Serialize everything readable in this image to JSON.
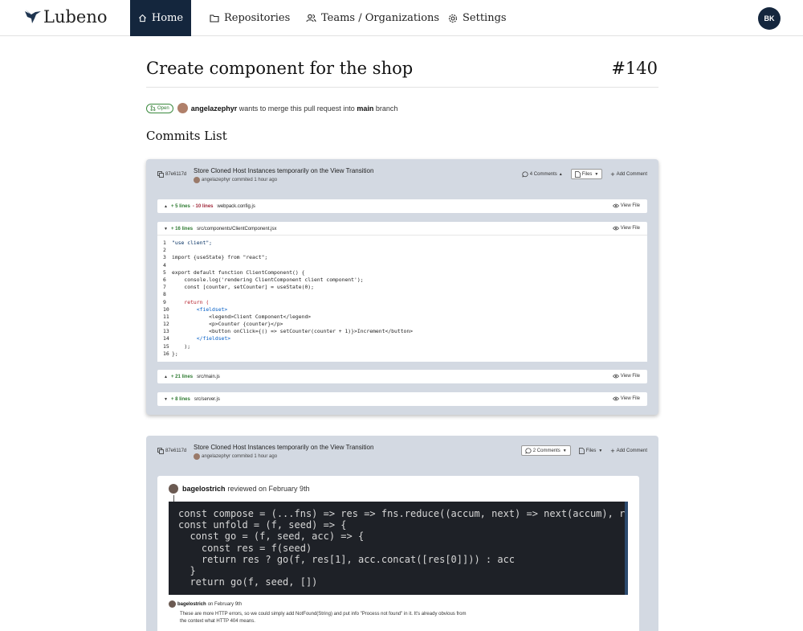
{
  "nav": {
    "brand": "Lubeno",
    "items": [
      {
        "label": "Home"
      },
      {
        "label": "Repositories"
      },
      {
        "label": "Teams / Organizations"
      },
      {
        "label": "Settings"
      }
    ],
    "user_initials": "BK",
    "colors": {
      "active_bg": "#14263d"
    }
  },
  "pr": {
    "title": "Create component for the shop",
    "number": "#140",
    "status": "Open",
    "author": "angelazephyr",
    "merge_text": "wants to merge this pull request into",
    "target_branch": "main",
    "branch_suffix": "branch"
  },
  "commits_list": {
    "title": "Commits List",
    "commits": [
      {
        "hash": "87e6117d",
        "message": "Store Cloned Host Instances temporarily on the View Transition",
        "author_line": "angelazephyr commited 1 hour ago",
        "comments_label": "4 Comments",
        "files_label": "Files",
        "add_comment_label": "Add Comment",
        "files": [
          {
            "added": "+ 5 lines",
            "removed": "- 10 lines",
            "name": "webpack.config.js",
            "view": "View File"
          },
          {
            "added": "+ 16 lines",
            "removed": "",
            "name": "src/components/ClientComponent.jsx",
            "view": "View File"
          },
          {
            "added": "+ 21 lines",
            "removed": "",
            "name": "src/main.js",
            "view": "View File"
          },
          {
            "added": "+ 8 lines",
            "removed": "",
            "name": "src/server.js",
            "view": "View File"
          }
        ],
        "code": [
          {
            "n": "1",
            "t": "\"use client\";"
          },
          {
            "n": "2",
            "t": ""
          },
          {
            "n": "3",
            "t": "import {useState} from \"react\";"
          },
          {
            "n": "4",
            "t": ""
          },
          {
            "n": "5",
            "t": "export default function ClientComponent() {"
          },
          {
            "n": "6",
            "t": "    console.log('rendering ClientComponent client component');"
          },
          {
            "n": "7",
            "t": "    const [counter, setCounter] = useState(0);"
          },
          {
            "n": "8",
            "t": ""
          },
          {
            "n": "9",
            "t": "    return ("
          },
          {
            "n": "10",
            "t": "        <fieldset>"
          },
          {
            "n": "11",
            "t": "            <legend>Client Component</legend>"
          },
          {
            "n": "12",
            "t": "            <p>Counter {counter}</p>"
          },
          {
            "n": "13",
            "t": "            <button onClick={() => setCounter(counter + 1)}>Increment</button>"
          },
          {
            "n": "14",
            "t": "        </fieldset>"
          },
          {
            "n": "15",
            "t": "    );"
          },
          {
            "n": "16",
            "t": "};"
          }
        ]
      },
      {
        "hash": "87e6117d",
        "message": "Store Cloned Host Instances temporarily on the View Transition",
        "author_line": "angelazephyr commited 1 hour ago",
        "comments_label": "2 Comments",
        "files_label": "Files",
        "add_comment_label": "Add Comment",
        "review": {
          "reviewer": "bagelostrich",
          "reviewed_text": "reviewed on February 9th",
          "code_lines": [
            "const compose = (...fns) => res => fns.reduce((accum, next) => next(accum), res)",
            "",
            "const unfold = (f, seed) => {",
            "  const go = (f, seed, acc) => {",
            "    const res = f(seed)",
            "    return res ? go(f, res[1], acc.concat([res[0]])) : acc",
            "  }",
            "  return go(f, seed, [])"
          ],
          "comment_author": "bagelostrich",
          "comment_date": "on February 9th",
          "comment_text": "These are more HTTP errors, so we could simply add NotFound(String) and put info \"Process not found\" in it. It's already obvious from the context what HTTP 404 means."
        }
      }
    ]
  }
}
